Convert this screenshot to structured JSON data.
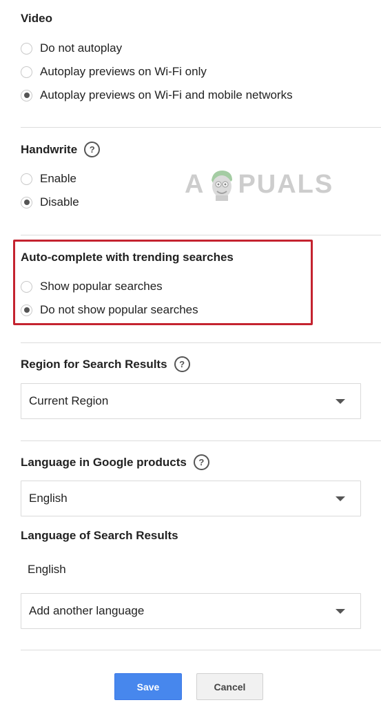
{
  "video": {
    "title": "Video",
    "options": [
      {
        "label": "Do not autoplay",
        "checked": false
      },
      {
        "label": "Autoplay previews on Wi-Fi only",
        "checked": false
      },
      {
        "label": "Autoplay previews on Wi-Fi and mobile networks",
        "checked": true
      }
    ]
  },
  "handwrite": {
    "title": "Handwrite",
    "help_icon": "help-icon",
    "options": [
      {
        "label": "Enable",
        "checked": false
      },
      {
        "label": "Disable",
        "checked": true
      }
    ]
  },
  "autocomplete": {
    "title": "Auto-complete with trending searches",
    "highlight_color": "#c4232f",
    "options": [
      {
        "label": "Show popular searches",
        "checked": false
      },
      {
        "label": "Do not show popular searches",
        "checked": true
      }
    ]
  },
  "region": {
    "title": "Region for Search Results",
    "help_icon": "help-icon",
    "selected": "Current Region"
  },
  "language_products": {
    "title": "Language in Google products",
    "help_icon": "help-icon",
    "selected": "English"
  },
  "language_results": {
    "title": "Language of Search Results",
    "current": "English",
    "add_placeholder": "Add another language"
  },
  "buttons": {
    "save_label": "Save",
    "cancel_label": "Cancel",
    "save_color": "#4787ed"
  },
  "watermark": {
    "text_left": "A",
    "text_right": "PUALS"
  }
}
